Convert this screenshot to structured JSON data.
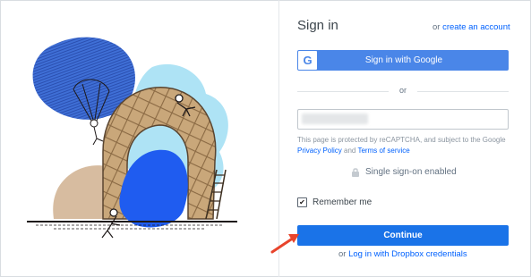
{
  "signin": {
    "title": "Sign in",
    "or_prefix": "or",
    "create_account": "create an account",
    "google_button": "Sign in with Google",
    "google_icon": "google-g-icon",
    "divider_text": "or",
    "email_placeholder": "Email",
    "recaptcha_text": "This page is protected by reCAPTCHA, and subject to the Google",
    "privacy_link": "Privacy Policy",
    "and_text": "and",
    "terms_link": "Terms of service",
    "sso_icon": "lock-icon",
    "sso_label": "Single sign-on enabled",
    "remember_label": "Remember me",
    "remember_checked": true,
    "continue_button": "Continue",
    "dropbox_prefix": "or",
    "dropbox_link": "Log in with Dropbox credentials"
  },
  "colors": {
    "accent": "#0061fe",
    "google_button": "#4a86e8",
    "continue_button": "#1a73e8",
    "annotation_arrow": "#e8442c"
  }
}
